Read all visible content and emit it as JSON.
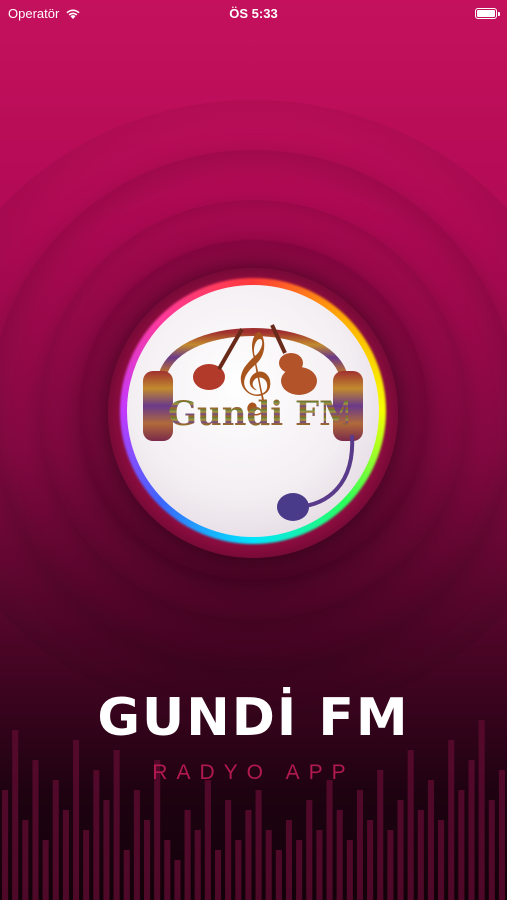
{
  "status_bar": {
    "carrier": "Operatör",
    "time": "ÖS 5:33"
  },
  "logo": {
    "text": "Gundi FM"
  },
  "app": {
    "title": "GUNDİ FM",
    "subtitle": "RADYO APP"
  },
  "equalizer": {
    "levels": [
      0.55,
      0.85,
      0.4,
      0.7,
      0.3,
      0.6,
      0.45,
      0.8,
      0.35,
      0.65,
      0.5,
      0.75,
      0.25,
      0.55,
      0.4,
      0.7,
      0.3,
      0.2,
      0.45,
      0.35,
      0.6,
      0.25,
      0.5,
      0.3,
      0.45,
      0.55,
      0.35,
      0.25,
      0.4,
      0.3,
      0.5,
      0.35,
      0.6,
      0.45,
      0.3,
      0.55,
      0.4,
      0.65,
      0.35,
      0.5,
      0.75,
      0.45,
      0.6,
      0.4,
      0.8,
      0.55,
      0.7,
      0.9,
      0.5,
      0.65
    ]
  },
  "colors": {
    "background_top": "#c5115d",
    "background_bottom": "#120109",
    "accent": "#b2194f",
    "bars": "#5a0a2e"
  }
}
